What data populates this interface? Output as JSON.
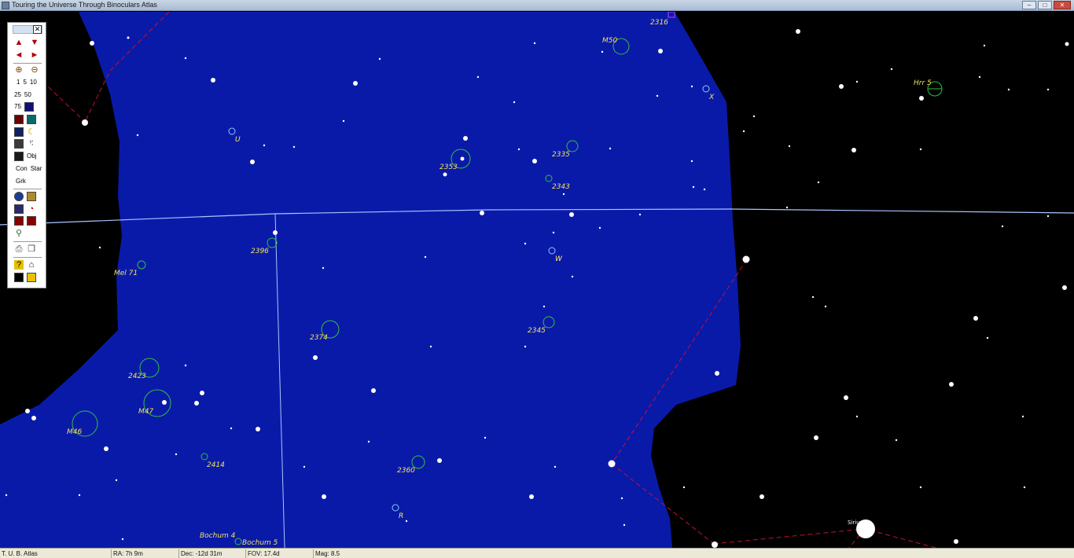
{
  "window": {
    "title": "Touring the Universe Through Binoculars Atlas",
    "controls": [
      "–",
      "□",
      "✕"
    ]
  },
  "toolbar": {
    "close_label": "✕",
    "zoom_levels_row1": [
      "1",
      "5",
      "10"
    ],
    "zoom_levels_row2": [
      "25",
      "50"
    ],
    "zoom_levels_row3": [
      "75"
    ],
    "obj_label": "Obj",
    "con_label": "Con",
    "star_label": "Star",
    "grk_label": "Grk"
  },
  "map": {
    "colors": {
      "milky_way": "#0a1aa8",
      "sky": "#000000",
      "object_circle": "#2fbf3f",
      "label": "#f2e35a",
      "grid": "#a9c4ff",
      "constellation_line": "#c8102e"
    },
    "object_labels": [
      {
        "id": "M50",
        "text": "M50"
      },
      {
        "id": "2316",
        "text": "2316"
      },
      {
        "id": "Hrr5",
        "text": "Hrr 5"
      },
      {
        "id": "2335",
        "text": "2335"
      },
      {
        "id": "2353",
        "text": "2353"
      },
      {
        "id": "2343",
        "text": "2343"
      },
      {
        "id": "2396",
        "text": "2396"
      },
      {
        "id": "Mel71",
        "text": "Mel 71"
      },
      {
        "id": "2374",
        "text": "2374"
      },
      {
        "id": "2345",
        "text": "2345"
      },
      {
        "id": "2423",
        "text": "2423"
      },
      {
        "id": "M47",
        "text": "M47"
      },
      {
        "id": "M46",
        "text": "M46"
      },
      {
        "id": "2414",
        "text": "2414"
      },
      {
        "id": "2360",
        "text": "2360"
      },
      {
        "id": "Bochum4",
        "text": "Bochum 4"
      },
      {
        "id": "Bochum5",
        "text": "Bochum 5"
      }
    ],
    "variable_labels": [
      "U",
      "X",
      "W",
      "R"
    ],
    "star_names": [
      "Sirius"
    ]
  },
  "status": {
    "app": "T. U. B. Atlas",
    "ra": "RA: 7h 9m",
    "dec": "Dec: -12d 31m",
    "fov": "FOV: 17.4d",
    "mag": "Mag: 8.5"
  }
}
